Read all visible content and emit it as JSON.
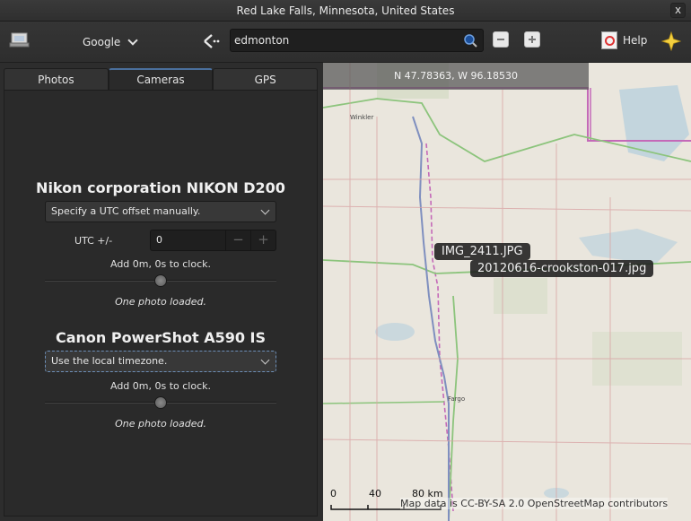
{
  "window": {
    "title": "Red Lake Falls, Minnesota, United States",
    "close_glyph": "x"
  },
  "toolbar": {
    "map_source": "Google",
    "search_value": "edmonton",
    "help_label": "Help"
  },
  "tabs": [
    {
      "label": "Photos",
      "active": false
    },
    {
      "label": "Cameras",
      "active": true
    },
    {
      "label": "GPS",
      "active": false
    }
  ],
  "cameras": [
    {
      "name": "Nikon corporation NIKON D200",
      "timezone_mode": "Specify a UTC offset manually.",
      "utc_label": "UTC +/-",
      "utc_value": "0",
      "minus": "−",
      "plus": "+",
      "clock_info": "Add 0m, 0s to clock.",
      "photo_status": "One photo loaded."
    },
    {
      "name": "Canon PowerShot A590 IS",
      "timezone_mode": "Use the local timezone.",
      "clock_info": "Add 0m, 0s to clock.",
      "photo_status": "One photo loaded."
    }
  ],
  "map": {
    "coordinates": "N 47.78363, W 96.18530",
    "labels": [
      "IMG_2411.JPG",
      "20120616-crookston-017.jpg"
    ],
    "towns": [
      "Winkler",
      "Fargo"
    ],
    "scale": {
      "zero": "0",
      "mid": "40",
      "end": "80 km"
    },
    "attribution": "Map data is CC-BY-SA 2.0 OpenStreetMap contributors"
  }
}
